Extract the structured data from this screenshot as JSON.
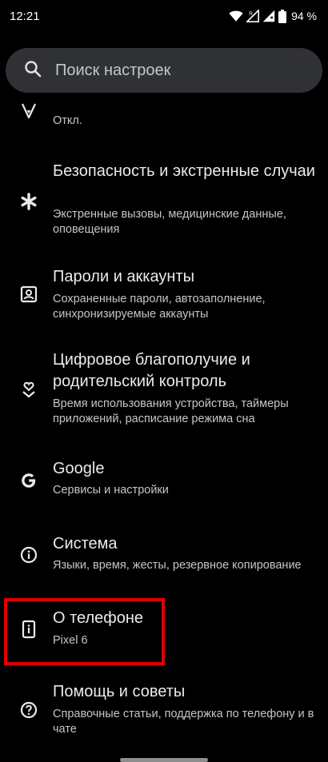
{
  "status_bar": {
    "time": "12:21",
    "battery": "94 %",
    "icons": [
      "wifi-icon",
      "signal-roaming-icon",
      "signal-icon",
      "battery-icon"
    ]
  },
  "search": {
    "placeholder": "Поиск настроек",
    "icon": "search-icon"
  },
  "items": [
    {
      "id": "location",
      "icon": "location-icon",
      "title": "",
      "summary": "Откл."
    },
    {
      "id": "safety",
      "icon": "asterisk-icon",
      "title": "Безопасность и экстренные случаи",
      "summary": "Экстренные вызовы, медицинские данные, оповещения"
    },
    {
      "id": "passwords",
      "icon": "account-box-icon",
      "title": "Пароли и аккаунты",
      "summary": "Сохраненные пароли, автозаполнение, синхронизируемые аккаунты"
    },
    {
      "id": "wellbeing",
      "icon": "wellbeing-icon",
      "title": "Цифровое благополучие и родительский контроль",
      "summary": "Время использования устройства, таймеры приложений, расписание режима сна"
    },
    {
      "id": "google",
      "icon": "google-icon",
      "title": "Google",
      "summary": "Сервисы и настройки"
    },
    {
      "id": "system",
      "icon": "info-icon",
      "title": "Система",
      "summary": "Языки, время, жесты, резервное копирование"
    },
    {
      "id": "about",
      "icon": "phone-info-icon",
      "title": "О телефоне",
      "summary": "Pixel 6"
    },
    {
      "id": "help",
      "icon": "help-icon",
      "title": "Помощь и советы",
      "summary": "Справочные статьи, поддержка по телефону и в чате"
    }
  ],
  "colors": {
    "background": "#000000",
    "search_bg": "#303135",
    "title": "#e8eaed",
    "summary": "#c4c7c5",
    "highlight": "#e00000"
  }
}
